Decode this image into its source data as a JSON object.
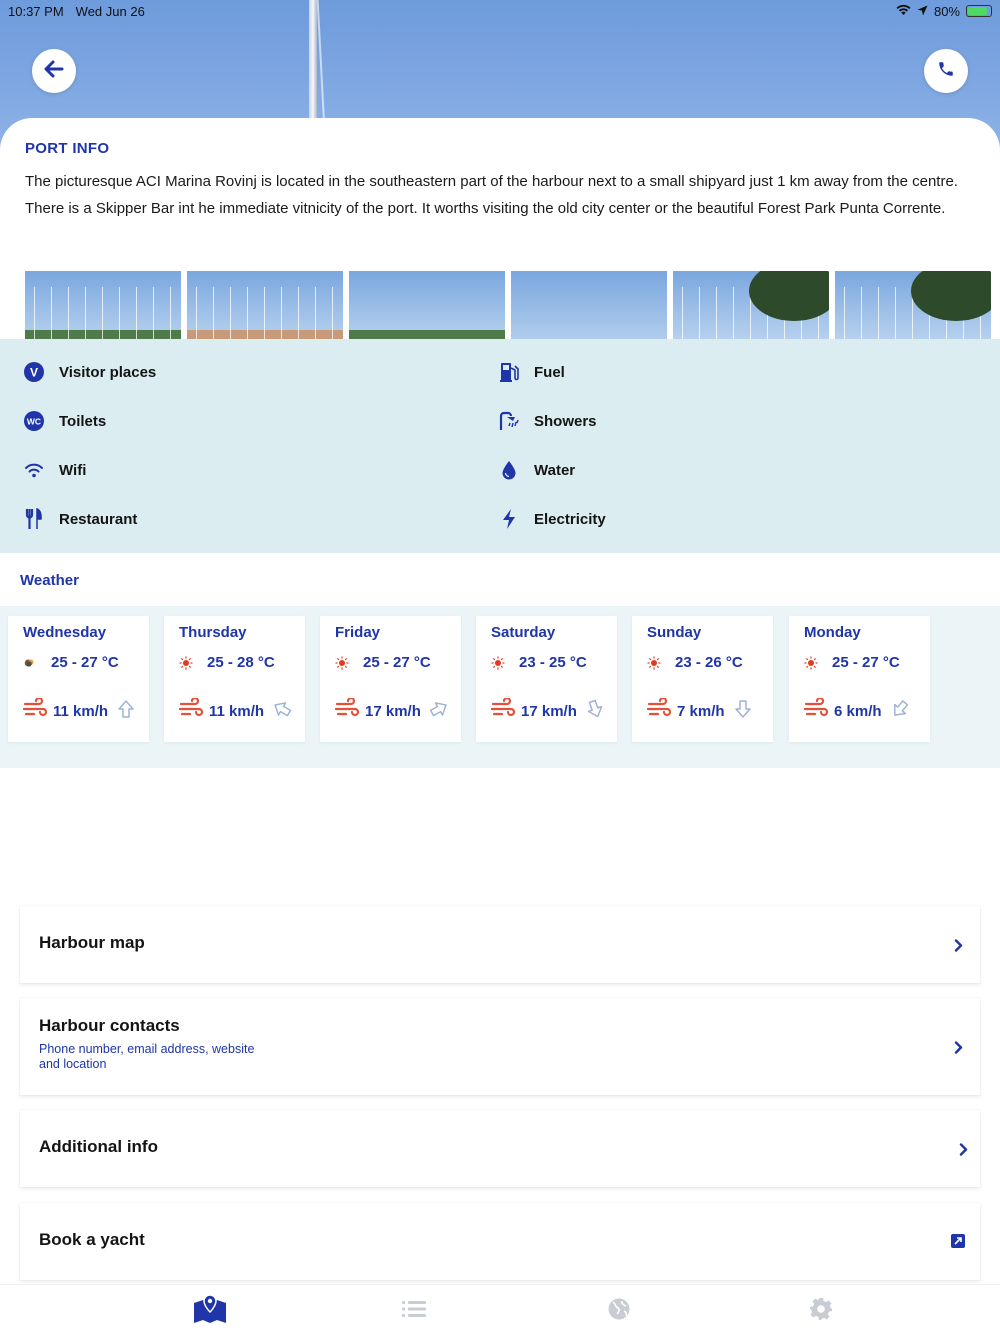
{
  "status": {
    "time": "10:37 PM",
    "date": "Wed Jun 26",
    "battery": "80%",
    "icons": [
      "wifi-icon",
      "location-arrow-icon",
      "battery-charging-icon"
    ]
  },
  "header": {
    "back_icon": "arrow-left-icon",
    "call_icon": "phone-icon"
  },
  "port": {
    "title": "PORT INFO",
    "description": "The picturesque ACI Marina Rovinj is located in the southeastern part of the harbour next to a small shipyard just 1 km away from the centre. There is a Skipper Bar int he immediate vitnicity of the port. It worths visiting the old city center or the beautiful Forest Park Punta Corrente."
  },
  "amenities": [
    {
      "label": "Visitor places",
      "icon": "visitor-v-icon"
    },
    {
      "label": "Fuel",
      "icon": "fuel-pump-icon"
    },
    {
      "label": "Toilets",
      "icon": "wc-icon"
    },
    {
      "label": "Showers",
      "icon": "shower-icon"
    },
    {
      "label": "Wifi",
      "icon": "wifi-icon"
    },
    {
      "label": "Water",
      "icon": "water-drop-icon"
    },
    {
      "label": "Restaurant",
      "icon": "fork-knife-icon"
    },
    {
      "label": "Electricity",
      "icon": "lightning-icon"
    }
  ],
  "weather": {
    "title": "Weather",
    "days": [
      {
        "day": "Wednesday",
        "temp": "25 - 27 °C",
        "wind": "11 km/h",
        "condition": "cloudy-sun-icon",
        "wind_dir_deg": 0
      },
      {
        "day": "Thursday",
        "temp": "25 - 28 °C",
        "wind": "11 km/h",
        "condition": "sun-icon",
        "wind_dir_deg": 300
      },
      {
        "day": "Friday",
        "temp": "25 - 27 °C",
        "wind": "17 km/h",
        "condition": "sun-icon",
        "wind_dir_deg": 60
      },
      {
        "day": "Saturday",
        "temp": "23 - 25 °C",
        "wind": "17 km/h",
        "condition": "sun-icon",
        "wind_dir_deg": 160
      },
      {
        "day": "Sunday",
        "temp": "23 - 26 °C",
        "wind": "7 km/h",
        "condition": "sun-icon",
        "wind_dir_deg": 180
      },
      {
        "day": "Monday",
        "temp": "25 - 27 °C",
        "wind": "6 km/h",
        "condition": "sun-icon",
        "wind_dir_deg": 220
      }
    ],
    "colors": {
      "accent": "#1f35a8",
      "sun": "#e23a1e",
      "wind": "#e5503a"
    }
  },
  "links": [
    {
      "title": "Harbour map",
      "subtitle": "",
      "icon": "chevron-right-icon"
    },
    {
      "title": "Harbour contacts",
      "subtitle": "Phone number, email address, website and location",
      "icon": "chevron-right-icon"
    },
    {
      "title": "Additional info",
      "subtitle": "",
      "icon": "chevron-right-icon"
    },
    {
      "title": "Book a yacht",
      "subtitle": "",
      "icon": "external-link-icon"
    }
  ],
  "tabbar": {
    "items": [
      {
        "icon": "map-pin-icon",
        "active": true
      },
      {
        "icon": "list-icon",
        "active": false
      },
      {
        "icon": "globe-icon",
        "active": false
      },
      {
        "icon": "settings-gear-icon",
        "active": false
      }
    ]
  }
}
